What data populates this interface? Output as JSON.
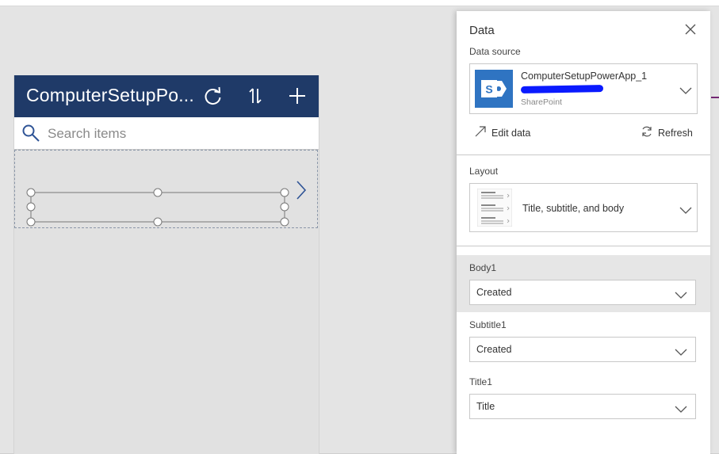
{
  "app": {
    "title": "ComputerSetupPo...",
    "search_placeholder": "Search items",
    "header_color": "#1f3a68",
    "icons": [
      "refresh-icon",
      "sort-icon",
      "add-icon"
    ]
  },
  "panel": {
    "title": "Data",
    "data_source_label": "Data source",
    "data_source": {
      "name": "ComputerSetupPowerApp_1",
      "type": "SharePoint",
      "logo_letter": "S"
    },
    "edit_data_label": "Edit data",
    "refresh_label": "Refresh",
    "layout_label": "Layout",
    "layout_value": "Title, subtitle, and body",
    "fields": [
      {
        "label": "Body1",
        "value": "Created"
      },
      {
        "label": "Subtitle1",
        "value": "Created"
      },
      {
        "label": "Title1",
        "value": "Title"
      }
    ]
  },
  "colors": {
    "sharepoint_blue": "#2f74c2",
    "redaction": "#0a1aff",
    "accent": "#742774"
  }
}
